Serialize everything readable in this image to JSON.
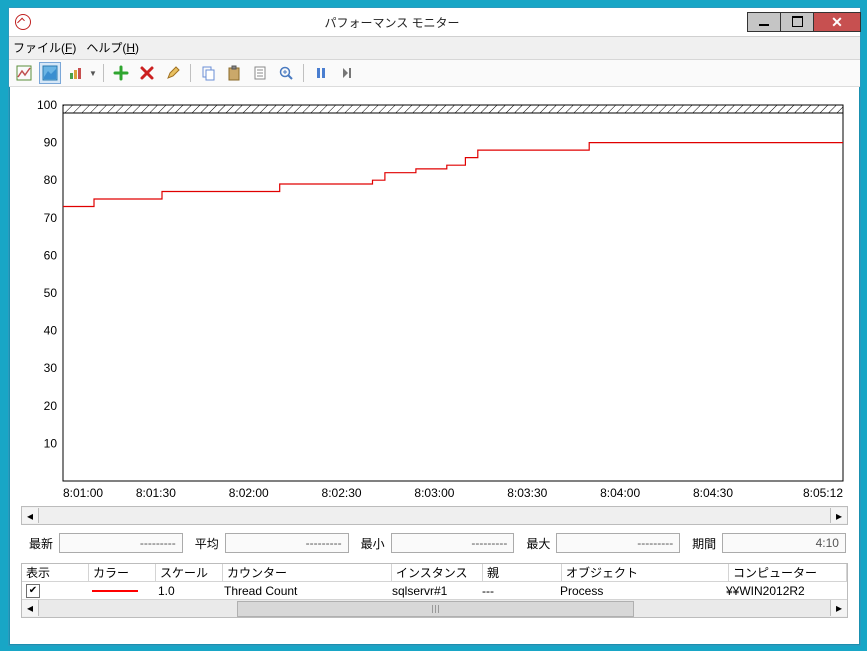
{
  "window": {
    "title": "パフォーマンス モニター"
  },
  "menu": {
    "file": "ファイル(F)",
    "help": "ヘルプ(H)"
  },
  "toolbar_icons": {
    "view_current": "view-line-icon",
    "view_history": "view-area-icon",
    "view_report": "view-report-icon",
    "add": "plus-icon",
    "delete": "x-icon",
    "highlight": "pencil-icon",
    "copy": "copy-icon",
    "paste": "clipboard-icon",
    "properties": "page-icon",
    "zoom": "zoom-icon",
    "freeze": "pause-icon",
    "update": "step-icon"
  },
  "stats": {
    "latest_label": "最新",
    "latest_value": "---------",
    "avg_label": "平均",
    "avg_value": "---------",
    "min_label": "最小",
    "min_value": "---------",
    "max_label": "最大",
    "max_value": "---------",
    "dur_label": "期間",
    "dur_value": "4:10"
  },
  "table": {
    "headers": {
      "show": "表示",
      "color": "カラー",
      "scale": "スケール",
      "counter": "カウンター",
      "instance": "インスタンス",
      "parent": "親",
      "object": "オブジェクト",
      "computer": "コンピューター"
    },
    "row": {
      "checked": true,
      "scale": "1.0",
      "counter": "Thread Count",
      "instance": "sqlservr#1",
      "parent": "---",
      "object": "Process",
      "computer": "¥¥WIN2012R2"
    }
  },
  "chart_data": {
    "type": "line",
    "title": "",
    "ylim": [
      0,
      100
    ],
    "yticks": [
      10,
      20,
      30,
      40,
      50,
      60,
      70,
      80,
      90,
      100
    ],
    "x_start_sec": 28860,
    "x_end_sec": 29112,
    "x_tick_labels": [
      "8:01:00",
      "8:01:30",
      "8:02:00",
      "8:02:30",
      "8:03:00",
      "8:03:30",
      "8:04:00",
      "8:04:30",
      "8:05:12"
    ],
    "x_tick_sec": [
      28860,
      28890,
      28920,
      28950,
      28980,
      29010,
      29040,
      29070,
      29112
    ],
    "series": [
      {
        "name": "Thread Count",
        "color": "#e00000",
        "points_sec_value": [
          [
            28860,
            73
          ],
          [
            28870,
            73
          ],
          [
            28870,
            75
          ],
          [
            28892,
            75
          ],
          [
            28892,
            77
          ],
          [
            28930,
            77
          ],
          [
            28930,
            79
          ],
          [
            28960,
            79
          ],
          [
            28960,
            80
          ],
          [
            28964,
            80
          ],
          [
            28964,
            82
          ],
          [
            28974,
            82
          ],
          [
            28974,
            83
          ],
          [
            28984,
            83
          ],
          [
            28984,
            84
          ],
          [
            28990,
            84
          ],
          [
            28990,
            86
          ],
          [
            28994,
            86
          ],
          [
            28994,
            88
          ],
          [
            29030,
            88
          ],
          [
            29030,
            90
          ],
          [
            29112,
            90
          ]
        ]
      }
    ]
  }
}
